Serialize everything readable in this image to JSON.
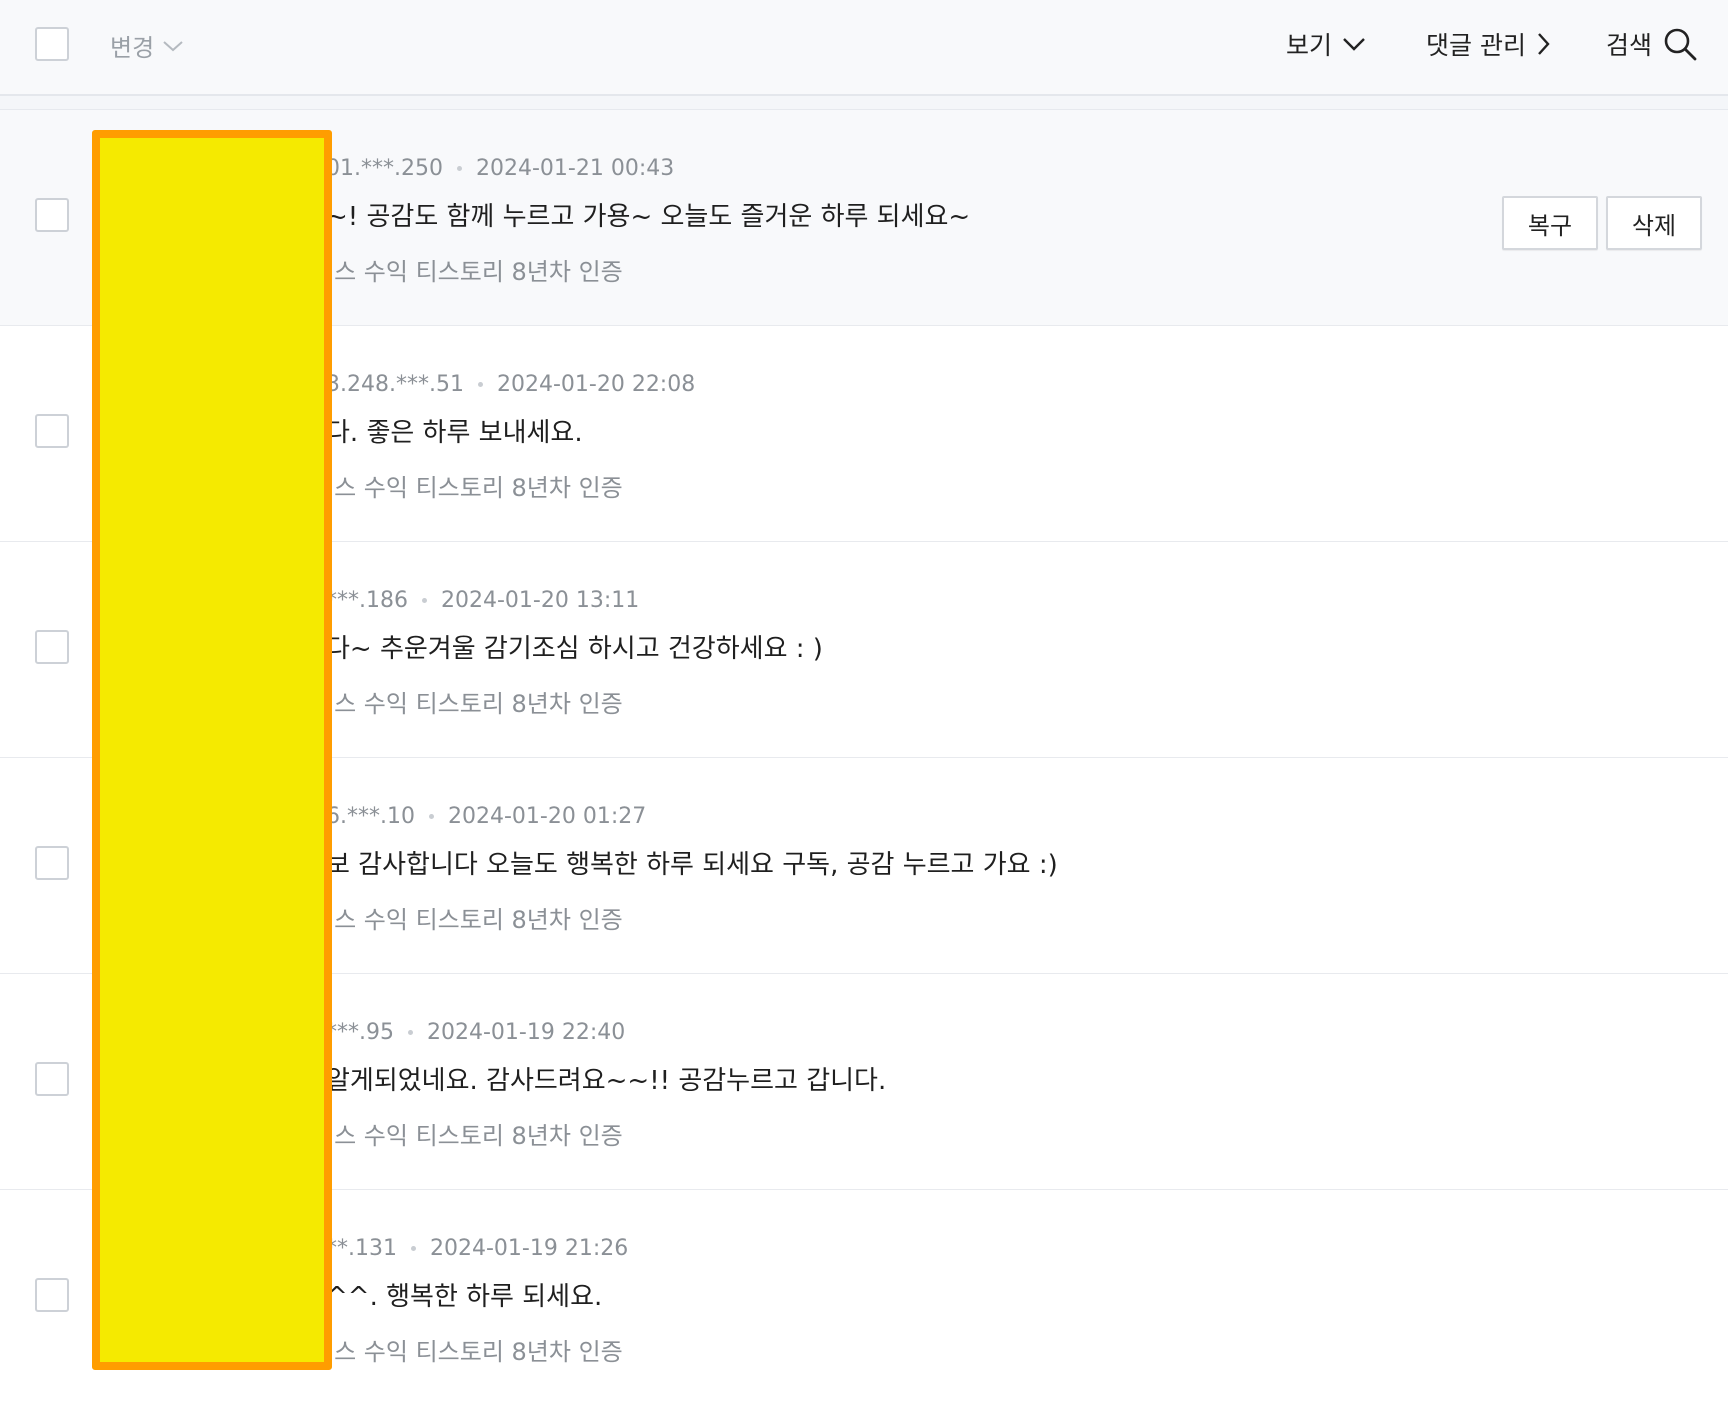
{
  "toolbar": {
    "change_label": "변경",
    "view_label": "보기",
    "comment_manage_label": "댓글 관리",
    "search_label": "검색"
  },
  "actions": {
    "restore_label": "복구",
    "delete_label": "삭제"
  },
  "comments": [
    {
      "ip": "01.***.250",
      "date": "2024-01-21 00:43",
      "text": "~! 공감도 함께 누르고 가용~ 오늘도 즐거운 하루 되세요~",
      "source": "|스 수익 티스토리 8년차 인증"
    },
    {
      "ip": "3.248.***.51",
      "date": "2024-01-20 22:08",
      "text": "다. 좋은 하루 보내세요.",
      "source": "|스 수익 티스토리 8년차 인증"
    },
    {
      "ip": "***.186",
      "date": "2024-01-20 13:11",
      "text": "다~ 추운겨울 감기조심 하시고 건강하세요 : )",
      "source": "|스 수익 티스토리 8년차 인증"
    },
    {
      "ip": "6.***.10",
      "date": "2024-01-20 01:27",
      "text": "보 감사합니다 오늘도 행복한 하루 되세요 구독, 공감 누르고 가요 :)",
      "source": "|스 수익 티스토리 8년차 인증"
    },
    {
      "ip": "***.95",
      "date": "2024-01-19 22:40",
      "text": "알게되었네요. 감사드려요~~!! 공감누르고 갑니다.",
      "source": "|스 수익 티스토리 8년차 인증"
    },
    {
      "ip": "**.131",
      "date": "2024-01-19 21:26",
      "text": "^^. 행복한 하루 되세요.",
      "source": "|스 수익 티스토리 8년차 인증"
    }
  ],
  "colors": {
    "highlight_fill": "#f5ea00",
    "highlight_border": "#ff9d00",
    "active_row_bg": "#f8f9fb"
  }
}
